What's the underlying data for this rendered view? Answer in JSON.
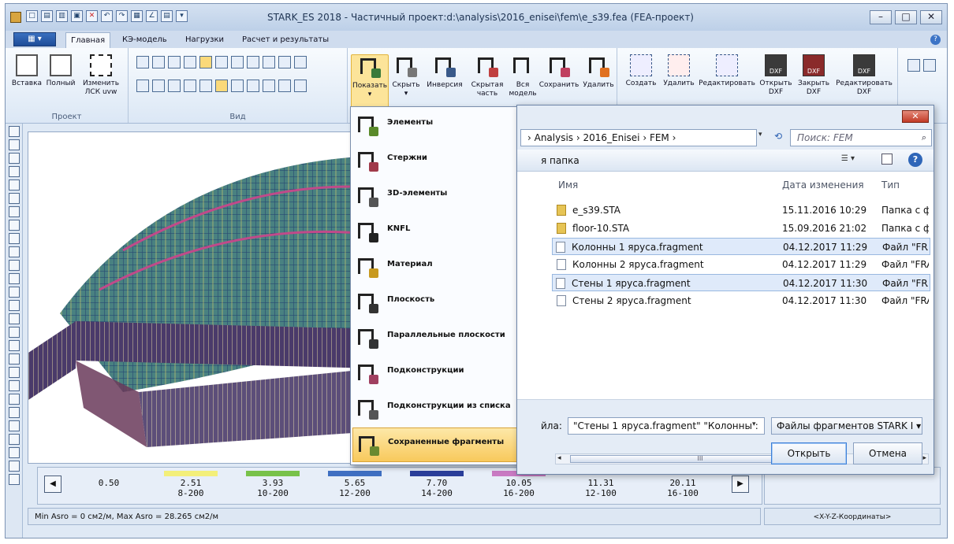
{
  "window": {
    "title": "STARK_ES 2018 - Частичный проект:d:\\analysis\\2016_enisei\\fem\\e_s39.fea  (FEA-проект)"
  },
  "tabs": [
    "Главная",
    "КЭ-модель",
    "Нагрузки",
    "Расчет и результаты"
  ],
  "ribbon": {
    "project": {
      "label": "Проект",
      "buttons": [
        "Вставка",
        "Полный",
        "Изменить ЛСК uvw"
      ]
    },
    "view": {
      "label": "Вид"
    },
    "fragments": [
      "Показать",
      "Скрыть",
      "Инверсия",
      "Скрытая часть",
      "Вся модель",
      "Сохранить",
      "Удалить"
    ],
    "dxf": [
      "Создать",
      "Удалить",
      "Редактировать",
      "Открыть DXF",
      "Закрыть DXF",
      "Редактировать DXF"
    ],
    "dxf_tag": "DXF"
  },
  "show_menu": {
    "items": [
      {
        "label": "Элементы",
        "color": "#5a8a2a"
      },
      {
        "label": "Стержни",
        "color": "#a03a4a"
      },
      {
        "label": "3D-элементы",
        "color": "#555555"
      },
      {
        "label": "KNFL",
        "color": "#222222"
      },
      {
        "label": "Материал",
        "color": "#c89a20"
      },
      {
        "label": "Плоскость",
        "color": "#333333"
      },
      {
        "label": "Параллельные плоскости",
        "color": "#333333"
      },
      {
        "label": "Подконструкции",
        "color": "#a04060"
      },
      {
        "label": "Подконструкции из списка",
        "color": "#555555"
      },
      {
        "label": "Сохраненные фрагменты",
        "color": "#6a8a30"
      }
    ],
    "highlighted": "Сохраненные фрагменты"
  },
  "dialog": {
    "address": "› Analysis › 2016_Enisei › FEM ›",
    "search_placeholder": "Поиск: FEM",
    "new_folder": "я папка",
    "columns": [
      "Имя",
      "Дата изменения",
      "Тип"
    ],
    "files": [
      {
        "name": "e_s39.STA",
        "date": "15.11.2016 10:29",
        "type": "Папка с ф",
        "kind": "folder",
        "selected": false
      },
      {
        "name": "floor-10.STA",
        "date": "15.09.2016 21:02",
        "type": "Папка с ф",
        "kind": "folder",
        "selected": false
      },
      {
        "name": "Колонны 1 яруса.fragment",
        "date": "04.12.2017 11:29",
        "type": "Файл \"FRA",
        "kind": "file",
        "selected": true
      },
      {
        "name": "Колонны 2 яруса.fragment",
        "date": "04.12.2017 11:29",
        "type": "Файл \"FRA",
        "kind": "file",
        "selected": false
      },
      {
        "name": "Стены 1 яруса.fragment",
        "date": "04.12.2017 11:30",
        "type": "Файл \"FRA",
        "kind": "file",
        "selected": true
      },
      {
        "name": "Стены 2 яруса.fragment",
        "date": "04.12.2017 11:30",
        "type": "Файл \"FRA",
        "kind": "file",
        "selected": false
      }
    ],
    "filename_label": "йла:",
    "filename_value": "\"Стены 1 яруса.fragment\" \"Колонны :",
    "filetype": "Файлы фрагментов STARK I ▾",
    "open": "Открыть",
    "cancel": "Отмена",
    "scroll_grip": "III"
  },
  "legend": {
    "cells": [
      {
        "value": "0.50",
        "sub": "",
        "color": ""
      },
      {
        "value": "2.51",
        "sub": "8-200",
        "color": "#f3ef7a"
      },
      {
        "value": "3.93",
        "sub": "10-200",
        "color": "#78c24a"
      },
      {
        "value": "5.65",
        "sub": "12-200",
        "color": "#3f6fc2"
      },
      {
        "value": "7.70",
        "sub": "14-200",
        "color": "#2a3e9a"
      },
      {
        "value": "10.05",
        "sub": "16-200",
        "color": "#c97ac3"
      },
      {
        "value": "11.31",
        "sub": "12-100",
        "color": ""
      },
      {
        "value": "20.11",
        "sub": "16-100",
        "color": ""
      }
    ]
  },
  "status": {
    "left": "Min Asro = 0 см2/м,  Max Asro = 28.265 см2/м",
    "right": "<X-Y-Z-Координаты>"
  }
}
